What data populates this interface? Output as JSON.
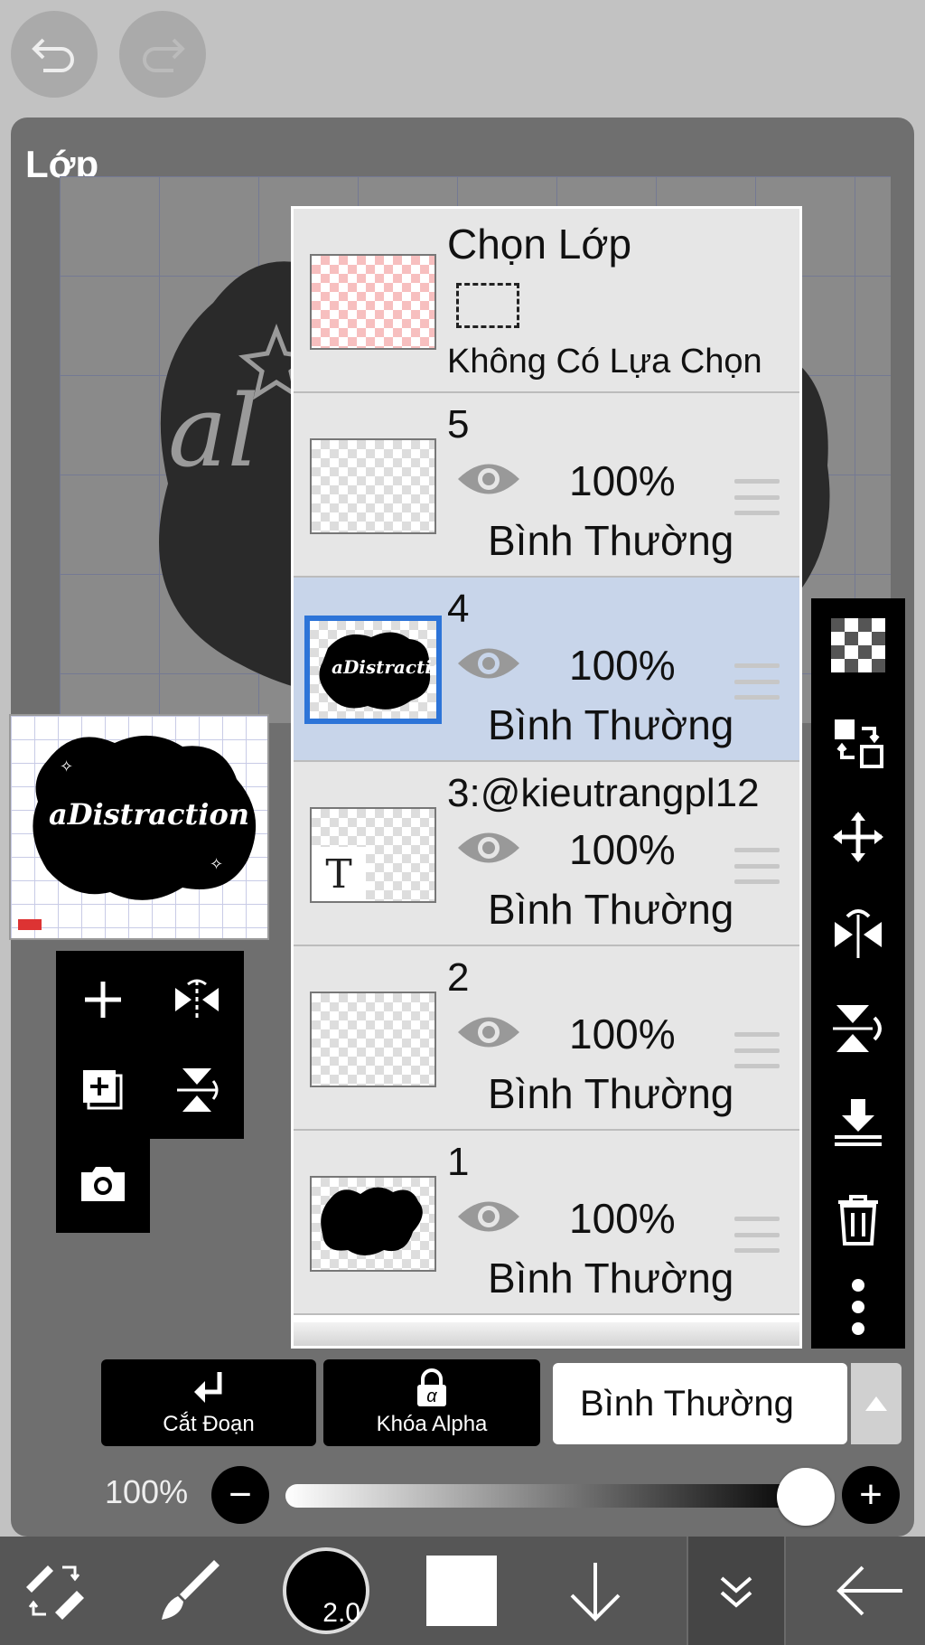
{
  "panel": {
    "title": "Lớp"
  },
  "selection_layer": {
    "title": "Chọn Lớp",
    "label": "Không Có Lựa Chọn"
  },
  "layers": [
    {
      "name": "5",
      "opacity": "100%",
      "blend": "Bình Thường",
      "thumbnail": "empty",
      "selected": false,
      "visible": true
    },
    {
      "name": "4",
      "opacity": "100%",
      "blend": "Bình Thường",
      "thumbnail": "cloud-artwork",
      "selected": true,
      "visible": true
    },
    {
      "name": "3:@kieutrangpl12",
      "opacity": "100%",
      "blend": "Bình Thường",
      "thumbnail": "text",
      "selected": false,
      "visible": true
    },
    {
      "name": "2",
      "opacity": "100%",
      "blend": "Bình Thường",
      "thumbnail": "empty",
      "selected": false,
      "visible": true
    },
    {
      "name": "1",
      "opacity": "100%",
      "blend": "Bình Thường",
      "thumbnail": "black-blob",
      "selected": false,
      "visible": true
    }
  ],
  "text_thumb_glyph": "T",
  "artwork": {
    "text": "aDistraction"
  },
  "actions": {
    "clip": "Cắt Đoạn",
    "alpha_lock": "Khóa Alpha",
    "alpha_symbol": "α"
  },
  "blend_mode": "Bình Thường",
  "layer_opacity": {
    "label": "100%",
    "value": 1.0,
    "minus": "−",
    "plus": "+"
  },
  "brush": {
    "size": "2.0"
  },
  "colors": {
    "selected_row": "#c8d5ea",
    "active_border": "#2d74d8",
    "panel": "#6f6f6f"
  }
}
